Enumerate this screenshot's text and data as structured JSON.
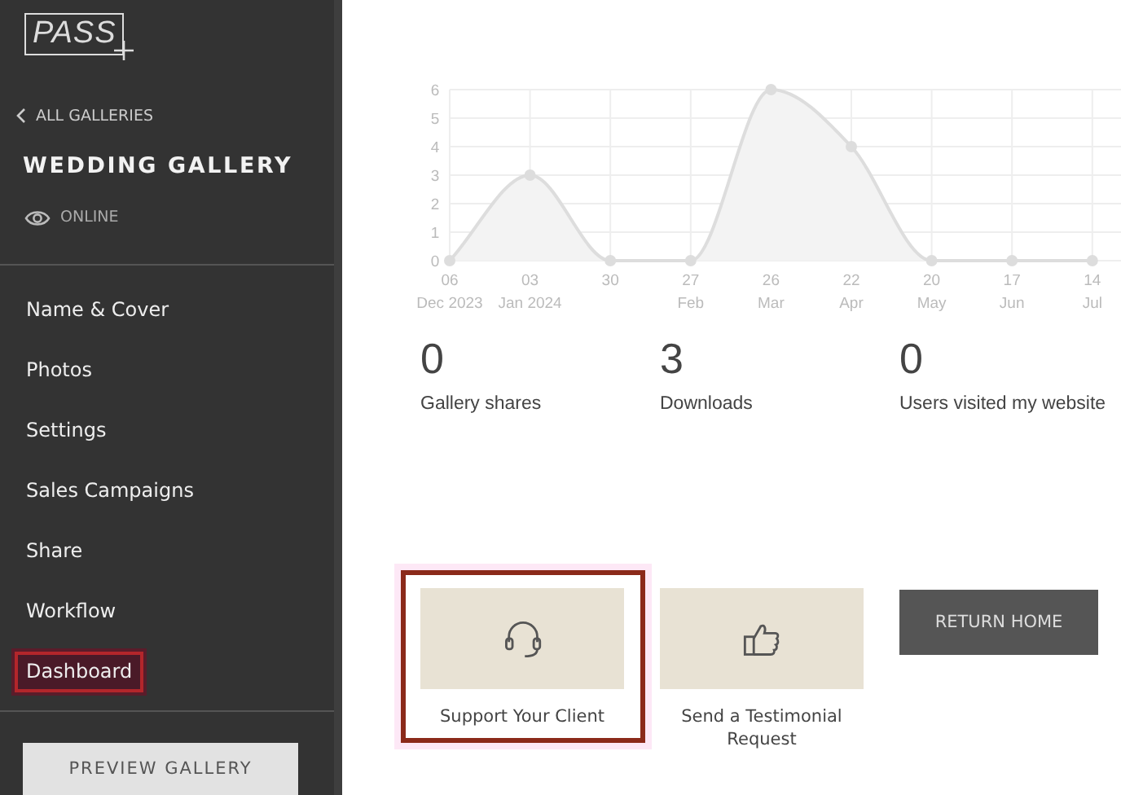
{
  "sidebar": {
    "logo": "PASS",
    "back_link": "ALL GALLERIES",
    "gallery_title": "WEDDING GALLERY",
    "status": "ONLINE",
    "nav_items": [
      {
        "label": "Name & Cover",
        "selected": false
      },
      {
        "label": "Photos",
        "selected": false
      },
      {
        "label": "Settings",
        "selected": false
      },
      {
        "label": "Sales Campaigns",
        "selected": false
      },
      {
        "label": "Share",
        "selected": false
      },
      {
        "label": "Workflow",
        "selected": false
      },
      {
        "label": "Dashboard",
        "selected": true
      }
    ],
    "preview_button": "PREVIEW GALLERY"
  },
  "main": {
    "chart_data": {
      "type": "area",
      "categories": [
        "06\nDec 2023",
        "03\nJan 2024",
        "30",
        "27\nFeb",
        "26\nMar",
        "22\nApr",
        "20\nMay",
        "17\nJun",
        "14\nJul"
      ],
      "yticks": [
        0,
        1,
        2,
        3,
        4,
        5,
        6
      ],
      "ylim": [
        0,
        6
      ],
      "grid": true,
      "series": [
        {
          "color": "#dddddd",
          "values": [
            0,
            3,
            0,
            0,
            6,
            4,
            0,
            0,
            0
          ]
        }
      ]
    },
    "stats": [
      {
        "value": "0",
        "label": "Gallery shares"
      },
      {
        "value": "3",
        "label": "Downloads"
      },
      {
        "value": "0",
        "label": "Users visited my website"
      }
    ],
    "actions": [
      {
        "kind": "support",
        "label": "Support Your Client",
        "highlighted": true
      },
      {
        "kind": "testimonial",
        "label": "Send a Testimonial Request",
        "highlighted": false
      }
    ],
    "return_button": "RETURN HOME"
  }
}
